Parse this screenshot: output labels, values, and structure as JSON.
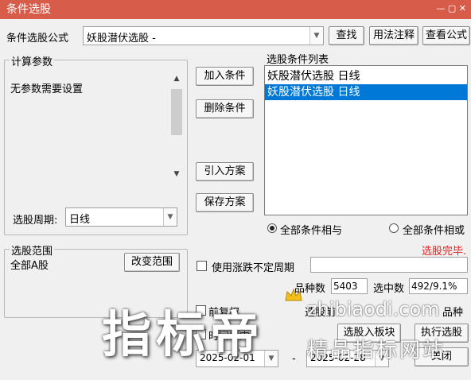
{
  "window": {
    "title": "条件选股",
    "controls": "— ▢ ✕"
  },
  "formula": {
    "label": "条件选股公式",
    "value": "妖股潜伏选股  -",
    "find": "查找",
    "usage": "用法注释",
    "view": "查看公式"
  },
  "params": {
    "title": "计算参数",
    "text": "无参数需要设置",
    "period_label": "选股周期:",
    "period_value": "日线"
  },
  "actions": {
    "add": "加入条件",
    "delete": "删除条件",
    "import": "引入方案",
    "save": "保存方案"
  },
  "condlist": {
    "title": "选股条件列表",
    "items": [
      "妖股潜伏选股  日线",
      "妖股潜伏选股  日线"
    ],
    "selected": 1
  },
  "logic": {
    "and": "全部条件相与",
    "or": "全部条件相或",
    "selected": "and"
  },
  "status": {
    "text": "选股完毕.",
    "color": "#e02020"
  },
  "range": {
    "title": "选股范围",
    "value": "全部A股",
    "change": "改变范围"
  },
  "volatile": {
    "label": "使用涨跌不定周期"
  },
  "stats": {
    "count_label": "品种数",
    "count": "5403",
    "selected_label": "选中数",
    "selected": "492/9.1%"
  },
  "options": {
    "fq": "前复权",
    "pre": "选股前",
    "types": "品种"
  },
  "dates": {
    "label": "时间段内",
    "start": "2025-02-01",
    "sep": "-",
    "end": "2025-02-28"
  },
  "bottom": {
    "to_block": "选股入板块",
    "run": "执行选股",
    "close": "关闭"
  },
  "watermark": {
    "big": "指标帝",
    "url": "zhibiaodi.com",
    "sub": "精品指标网站"
  }
}
